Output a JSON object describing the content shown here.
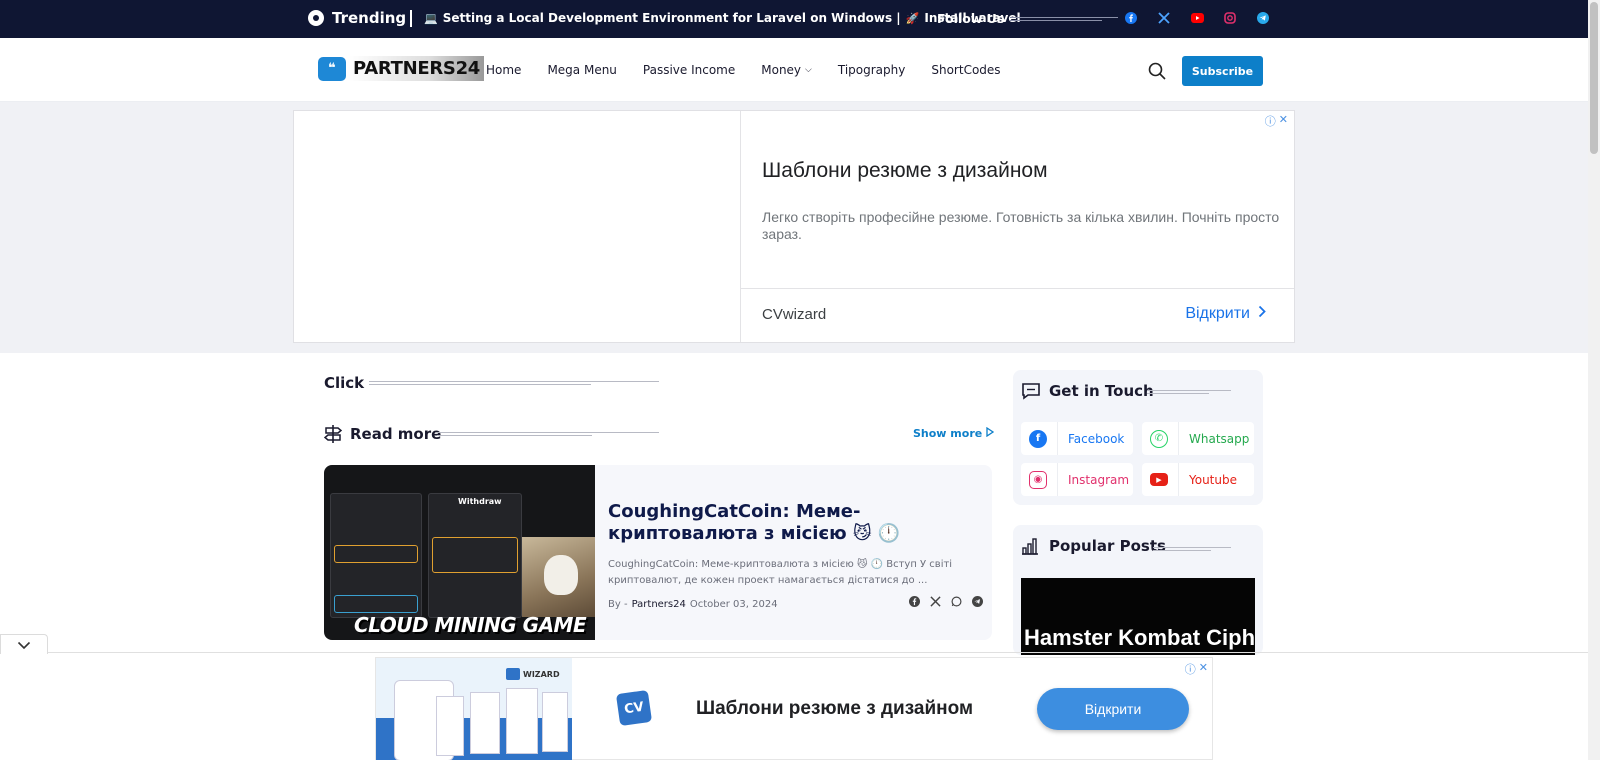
{
  "topbar": {
    "trending_label": "Trending",
    "headline_emoji_1": "💻",
    "headline_text": "Setting a Local Development Environment for Laravel on Windows |",
    "headline_emoji_2": "🚀",
    "headline_text_2": "Install Laravel",
    "follow_label": "Follow Us",
    "socials": [
      "facebook-icon",
      "x-icon",
      "youtube-icon",
      "instagram-icon",
      "telegram-icon"
    ],
    "colors": {
      "background": "#0f1633"
    }
  },
  "header": {
    "logo_text": "PARTNERS24",
    "nav": [
      "Home",
      "Mega Menu",
      "Passive Income",
      "Money",
      "Tipography",
      "ShortCodes"
    ],
    "subscribe_label": "Subscribe",
    "accent": "#0d7fc9"
  },
  "top_ad": {
    "title": "Шаблони резюме з дизайном",
    "description": "Легко створіть професійне резюме. Готовність за кілька хвилин. Почніть просто зараз.",
    "brand": "CVwizard",
    "cta": "Відкрити"
  },
  "main": {
    "click_heading": "Click",
    "read_more_heading": "Read more",
    "show_more": "Show more",
    "post": {
      "title": "CoughingCatCoin: Меме-криптовалюта з місією 😼 🕛 Пасивний заробіток на...",
      "excerpt": "CoughingCatCoin: Меме-криптовалюта з місією 😼 🕛 Вступ У світі криптовалют, де кожен проект намагається дістатися до ...",
      "by": "By -",
      "author": "Partners24",
      "date": "October 03, 2024",
      "thumb_title": "CLOUD MINING GAME",
      "thumb_withdraw": "Withdraw",
      "share": [
        "facebook-icon",
        "x-icon",
        "whatsapp-icon",
        "telegram-icon"
      ]
    }
  },
  "sidebar": {
    "get_in_touch": "Get in Touch",
    "socials": [
      {
        "label": "Facebook",
        "color": "#1877f2"
      },
      {
        "label": "Whatsapp",
        "color": "#25d366"
      },
      {
        "label": "Instagram",
        "color": "#e1306c"
      },
      {
        "label": "Youtube",
        "color": "#e62117"
      }
    ],
    "popular_posts": "Popular Posts",
    "popular_thumb_text": "Hamster Kombat Ciph"
  },
  "bottom_ad": {
    "title": "Шаблони резюме з дизайном",
    "cta": "Відкрити",
    "brand_mark": "WIZARD",
    "logo_text": "CV"
  }
}
